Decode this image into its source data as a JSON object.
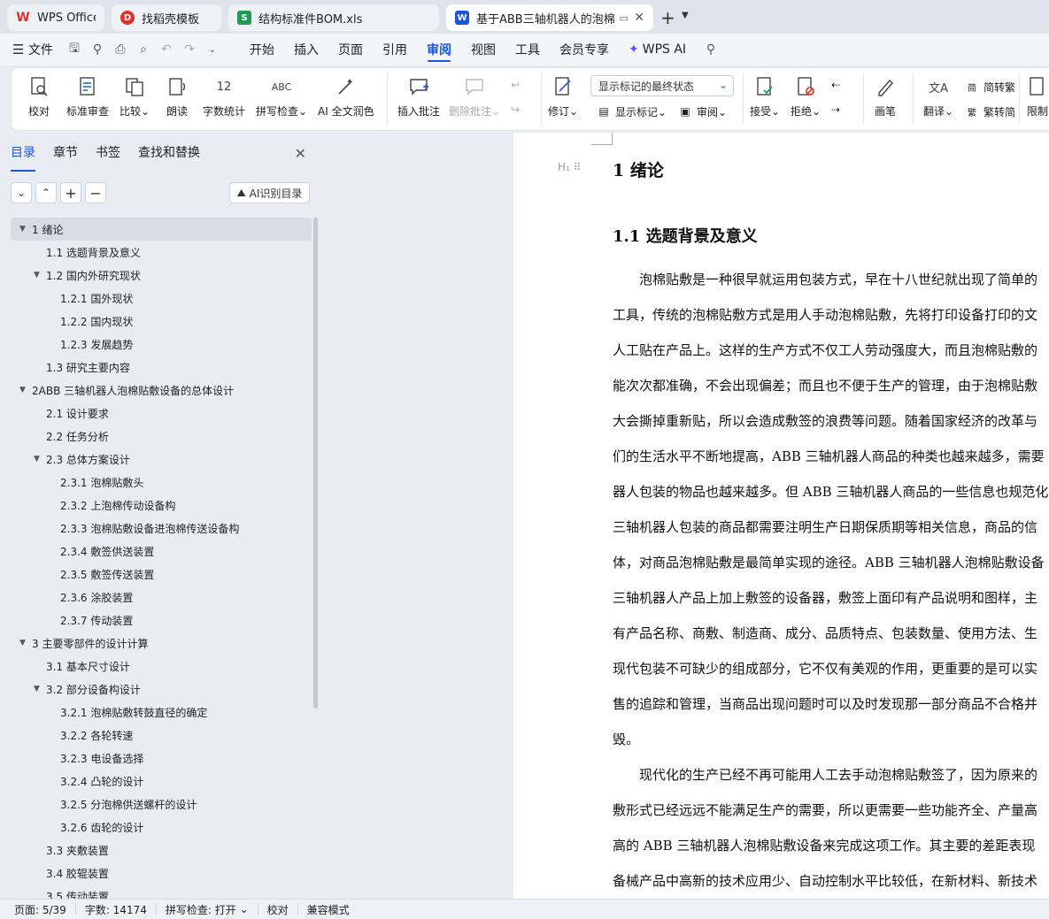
{
  "tabs": [
    {
      "label": "WPS Office",
      "icon": "wps-logo-icon",
      "color": "#e0302a"
    },
    {
      "label": "找稻壳模板",
      "icon": "docer-icon",
      "color": "#e0302a"
    },
    {
      "label": "结构标准件BOM.xls",
      "icon": "spreadsheet-icon",
      "color": "#1f9a56"
    },
    {
      "label": "基于ABB三轴机器人的泡棉贴",
      "icon": "writer-icon",
      "color": "#1a56db"
    }
  ],
  "menu": {
    "file": "文件",
    "items": [
      "开始",
      "插入",
      "页面",
      "引用",
      "审阅",
      "视图",
      "工具",
      "会员专享"
    ],
    "active": "审阅",
    "wps_ai": "WPS AI"
  },
  "ribbon": {
    "proofread": "校对",
    "standard_review": "标准审查",
    "compare": "比较",
    "read_aloud": "朗读",
    "word_count": "字数统计",
    "spell_check": "拼写检查",
    "ai_polish": "AI 全文润色",
    "insert_comment": "插入批注",
    "delete_comment": "删除批注",
    "track": "修订",
    "markup_select": "显示标记的最终状态",
    "show_markup": "显示标记",
    "review_pane": "审阅",
    "accept": "接受",
    "reject": "拒绝",
    "ink": "画笔",
    "translate": "翻译",
    "to_traditional": "简转繁",
    "to_simplified": "繁转简",
    "restrict": "限制"
  },
  "nav": {
    "tabs": [
      "目录",
      "章节",
      "书签",
      "查找和替换"
    ],
    "ai_toc": "AI识别目录",
    "toc": [
      {
        "label": "1 绪论",
        "level": 0,
        "expanded": true,
        "selected": true
      },
      {
        "label": "1.1 选题背景及意义",
        "level": 1
      },
      {
        "label": "1.2 国内外研究现状",
        "level": 1,
        "expanded": true
      },
      {
        "label": "1.2.1 国外现状",
        "level": 2
      },
      {
        "label": "1.2.2 国内现状",
        "level": 2
      },
      {
        "label": "1.2.3 发展趋势",
        "level": 2
      },
      {
        "label": "1.3 研究主要内容",
        "level": 1
      },
      {
        "label": "2ABB 三轴机器人泡棉贴敷设备的总体设计",
        "level": 0,
        "expanded": true
      },
      {
        "label": "2.1 设计要求",
        "level": 1
      },
      {
        "label": "2.2 任务分析",
        "level": 1
      },
      {
        "label": "2.3 总体方案设计",
        "level": 1,
        "expanded": true
      },
      {
        "label": "2.3.1 泡棉贴敷头",
        "level": 2
      },
      {
        "label": "2.3.2 上泡棉传动设备构",
        "level": 2
      },
      {
        "label": "2.3.3 泡棉贴敷设备进泡棉传送设备构",
        "level": 2
      },
      {
        "label": "2.3.4 敷签供送装置",
        "level": 2
      },
      {
        "label": "2.3.5 敷签传送装置",
        "level": 2
      },
      {
        "label": "2.3.6 涂胶装置",
        "level": 2
      },
      {
        "label": "2.3.7 传动装置",
        "level": 2
      },
      {
        "label": "3 主要零部件的设计计算",
        "level": 0,
        "expanded": true
      },
      {
        "label": "3.1 基本尺寸设计",
        "level": 1
      },
      {
        "label": "3.2 部分设备构设计",
        "level": 1,
        "expanded": true
      },
      {
        "label": "3.2.1 泡棉贴敷转鼓直径的确定",
        "level": 2
      },
      {
        "label": "3.2.2 各轮转速",
        "level": 2
      },
      {
        "label": "3.2.3 电设备选择",
        "level": 2
      },
      {
        "label": "3.2.4 凸轮的设计",
        "level": 2
      },
      {
        "label": "3.2.5 分泡棉供送螺杆的设计",
        "level": 2
      },
      {
        "label": "3.2.6 齿轮的设计",
        "level": 2
      },
      {
        "label": "3.3 夹敷装置",
        "level": 1
      },
      {
        "label": "3.4 胶辊装置",
        "level": 1
      },
      {
        "label": "3.5 传动装置",
        "level": 1
      }
    ]
  },
  "document": {
    "heading1": "1 绪论",
    "heading2": "1.1 选题背景及意义",
    "para1": [
      "　　泡棉贴敷是一种很早就运用包装方式，早在十八世纪就出现了简单的",
      "工具，传统的泡棉贴敷方式是用人手动泡棉贴敷，先将打印设备打印的文",
      "人工贴在产品上。这样的生产方式不仅工人劳动强度大，而且泡棉贴敷的",
      "能次次都准确，不会出现偏差；而且也不便于生产的管理，由于泡棉贴敷",
      "大会撕掉重新贴，所以会造成敷签的浪费等问题。随着国家经济的改革与",
      "们的生活水平不断地提高，ABB 三轴机器人商品的种类也越来越多，需要",
      "器人包装的物品也越来越多。但 ABB 三轴机器人商品的一些信息也规范化",
      "三轴机器人包装的商品都需要注明生产日期保质期等相关信息，商品的信",
      "体，对商品泡棉贴敷是最简单实现的途径。ABB 三轴机器人泡棉贴敷设备",
      "三轴机器人产品上加上敷签的设备器，敷签上面印有产品说明和图样，主",
      "有产品名称、商敷、制造商、成分、品质特点、包装数量、使用方法、生",
      "现代包装不可缺少的组成部分，它不仅有美观的作用，更重要的是可以实",
      "售的追踪和管理，当商品出现问题时可以及时发现那一部分商品不合格并",
      "毁。"
    ],
    "para2": [
      "　　现代化的生产已经不再可能用人工去手动泡棉贴敷签了，因为原来的",
      "敷形式已经远远不能满足生产的需要，所以更需要一些功能齐全、产量高",
      "高的 ABB 三轴机器人泡棉贴敷设备来完成这项工作。其主要的差距表现",
      "备械产品中高新的技术应用少、自动控制水平比较低，在新材料、新技术"
    ]
  },
  "status": {
    "page": "页面: 5/39",
    "words": "字数: 14174",
    "spell": "拼写检查: 打开",
    "proof": "校对",
    "compat": "兼容模式"
  }
}
